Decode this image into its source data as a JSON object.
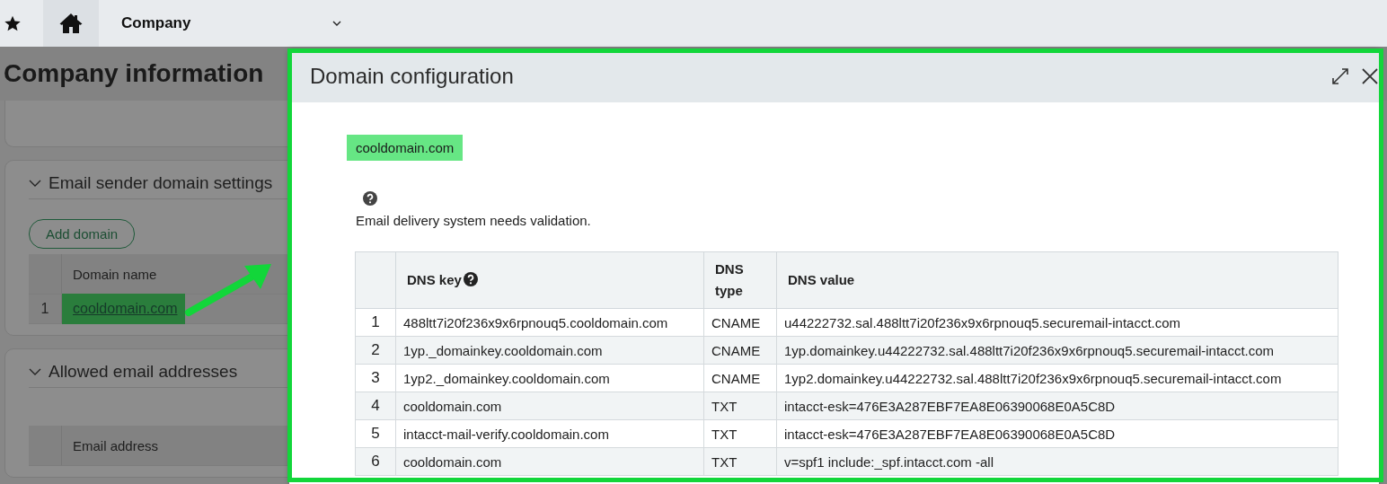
{
  "top_bar": {
    "home_selected": true,
    "menu": "Company"
  },
  "page": {
    "title": "Company information",
    "sections": [
      {
        "title": "Email sender domain settings",
        "expanded": true,
        "button": "Add domain",
        "column": "Domain name",
        "rows": [
          {
            "index": "1",
            "domain": "cooldomain.com",
            "highlighted": true
          }
        ]
      },
      {
        "title": "Allowed email addresses",
        "expanded": true,
        "column": "Email address"
      }
    ]
  },
  "dialog": {
    "title": "Domain configuration",
    "domain": "cooldomain.com",
    "domain_highlighted": true,
    "message": "Email delivery system needs validation.",
    "columns": [
      {
        "label": "DNS key",
        "help": true
      },
      {
        "label": "DNS type",
        "help": false
      },
      {
        "label": "DNS value",
        "help": false
      }
    ],
    "rows": [
      {
        "index": "1",
        "key": "488ltt7i20f236x9x6rpnouq5.cooldomain.com",
        "type": "CNAME",
        "value": "u44222732.sal.488ltt7i20f236x9x6rpnouq5.securemail-intacct.com"
      },
      {
        "index": "2",
        "key": "1yp._domainkey.cooldomain.com",
        "type": "CNAME",
        "value": "1yp.domainkey.u44222732.sal.488ltt7i20f236x9x6rpnouq5.securemail-intacct.com"
      },
      {
        "index": "3",
        "key": "1yp2._domainkey.cooldomain.com",
        "type": "CNAME",
        "value": "1yp2.domainkey.u44222732.sal.488ltt7i20f236x9x6rpnouq5.securemail-intacct.com"
      },
      {
        "index": "4",
        "key": "cooldomain.com",
        "type": "TXT",
        "value": "intacct-esk=476E3A287EBF7EA8E06390068E0A5C8D"
      },
      {
        "index": "5",
        "key": "intacct-mail-verify.cooldomain.com",
        "type": "TXT",
        "value": "intacct-esk=476E3A287EBF7EA8E06390068E0A5C8D"
      },
      {
        "index": "6",
        "key": "cooldomain.com",
        "type": "TXT",
        "value": "v=spf1 include:_spf.intacct.com -all"
      }
    ]
  },
  "annotation_frame": {
    "color": "#12d63a"
  },
  "annotation_arrow": {
    "color": "#12d63a"
  }
}
